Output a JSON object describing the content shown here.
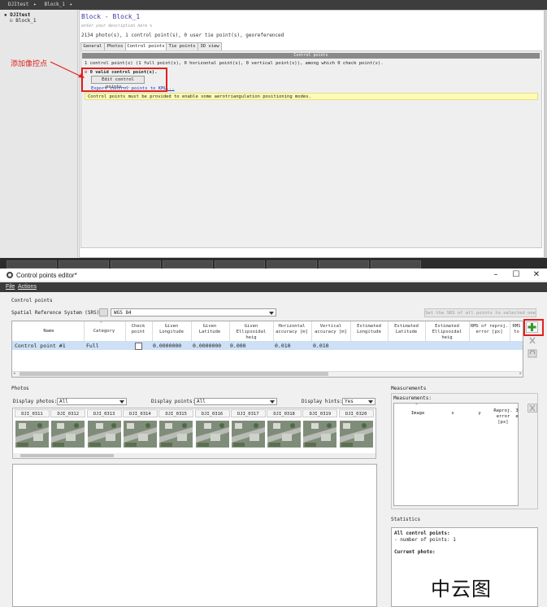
{
  "top_window": {
    "breadcrumb": [
      "DJItest",
      "Block_1"
    ],
    "tree": {
      "project": "DJItest",
      "block": "Block_1"
    },
    "block_title": "Block - Block_1",
    "description_placeholder": "enter your description here",
    "summary": "2134 photo(s), 1 control point(s), 0 user tie point(s), georeferenced",
    "tabs": [
      "General",
      "Photos",
      "Control points",
      "Tie points",
      "3D view"
    ],
    "active_tab": "Control points",
    "panel_header": "Control points",
    "counts_line": "1 control point(s) (1 full point(s), 0 horizontal point(s), 0 vertical point(s)), among which 0 check point(s).",
    "valid_line": "0 valid control point(s).",
    "edit_button": "Edit control points...",
    "export_link": "Export control points to KML...",
    "warning": "Control points must be provided to enable some aerotriangulation positioning modes.",
    "annotation": "添加像控点"
  },
  "editor": {
    "title": "Control points editor*",
    "menu": [
      "File",
      "Actions"
    ],
    "section_label": "Control points",
    "srs_label": "Spatial Reference System (SRS):",
    "srs_value": "WGS 84",
    "set_srs_button": "Set the SRS of all points to selected one",
    "table": {
      "columns": [
        [
          "Name"
        ],
        [
          "Category"
        ],
        [
          "Check",
          "point"
        ],
        [
          "Given",
          "Longitude"
        ],
        [
          "Given",
          "Latitude"
        ],
        [
          "Given",
          "Ellipsoidal heig"
        ],
        [
          "Horizontal",
          "accuracy [m]"
        ],
        [
          "Vertical",
          "accuracy [m]"
        ],
        [
          "Estimated",
          "Longitude"
        ],
        [
          "Estimated",
          "Latitude"
        ],
        [
          "Estimated",
          "Ellipsoidal heig"
        ],
        [
          "RMS of reproj.",
          "error [px]"
        ],
        [
          "RMS",
          "to"
        ]
      ],
      "rows": [
        {
          "name": "Control point #1",
          "category": "Full",
          "check": false,
          "lon": "0.0000000",
          "lat": "0.0000000",
          "height": "0.000",
          "h_acc": "0.010",
          "v_acc": "0.010"
        }
      ]
    },
    "photos": {
      "label": "Photos",
      "display_photos_label": "Display photos:",
      "display_photos_value": "All",
      "display_points_label": "Display points:",
      "display_points_value": "All",
      "display_hints_label": "Display hints:",
      "display_hints_value": "Yes",
      "thumbnails": [
        "DJI_0311",
        "DJI_0312",
        "DJI_0313",
        "DJI_0314",
        "DJI_0315",
        "DJI_0316",
        "DJI_0317",
        "DJI_0318",
        "DJI_0319",
        "DJI_0320"
      ]
    },
    "measurements": {
      "label": "Measurements",
      "sub_label": "Measurements:",
      "columns": [
        [
          "Image"
        ],
        [
          "x"
        ],
        [
          "y"
        ],
        [
          "Reproj.",
          "error [px]"
        ],
        [
          "3",
          "e"
        ]
      ]
    },
    "statistics": {
      "label": "Statistics",
      "all_cp_title": "All control points:",
      "points_line": "- number of points: 1",
      "current_photo": "Current photo:"
    },
    "watermark": "中云图"
  }
}
